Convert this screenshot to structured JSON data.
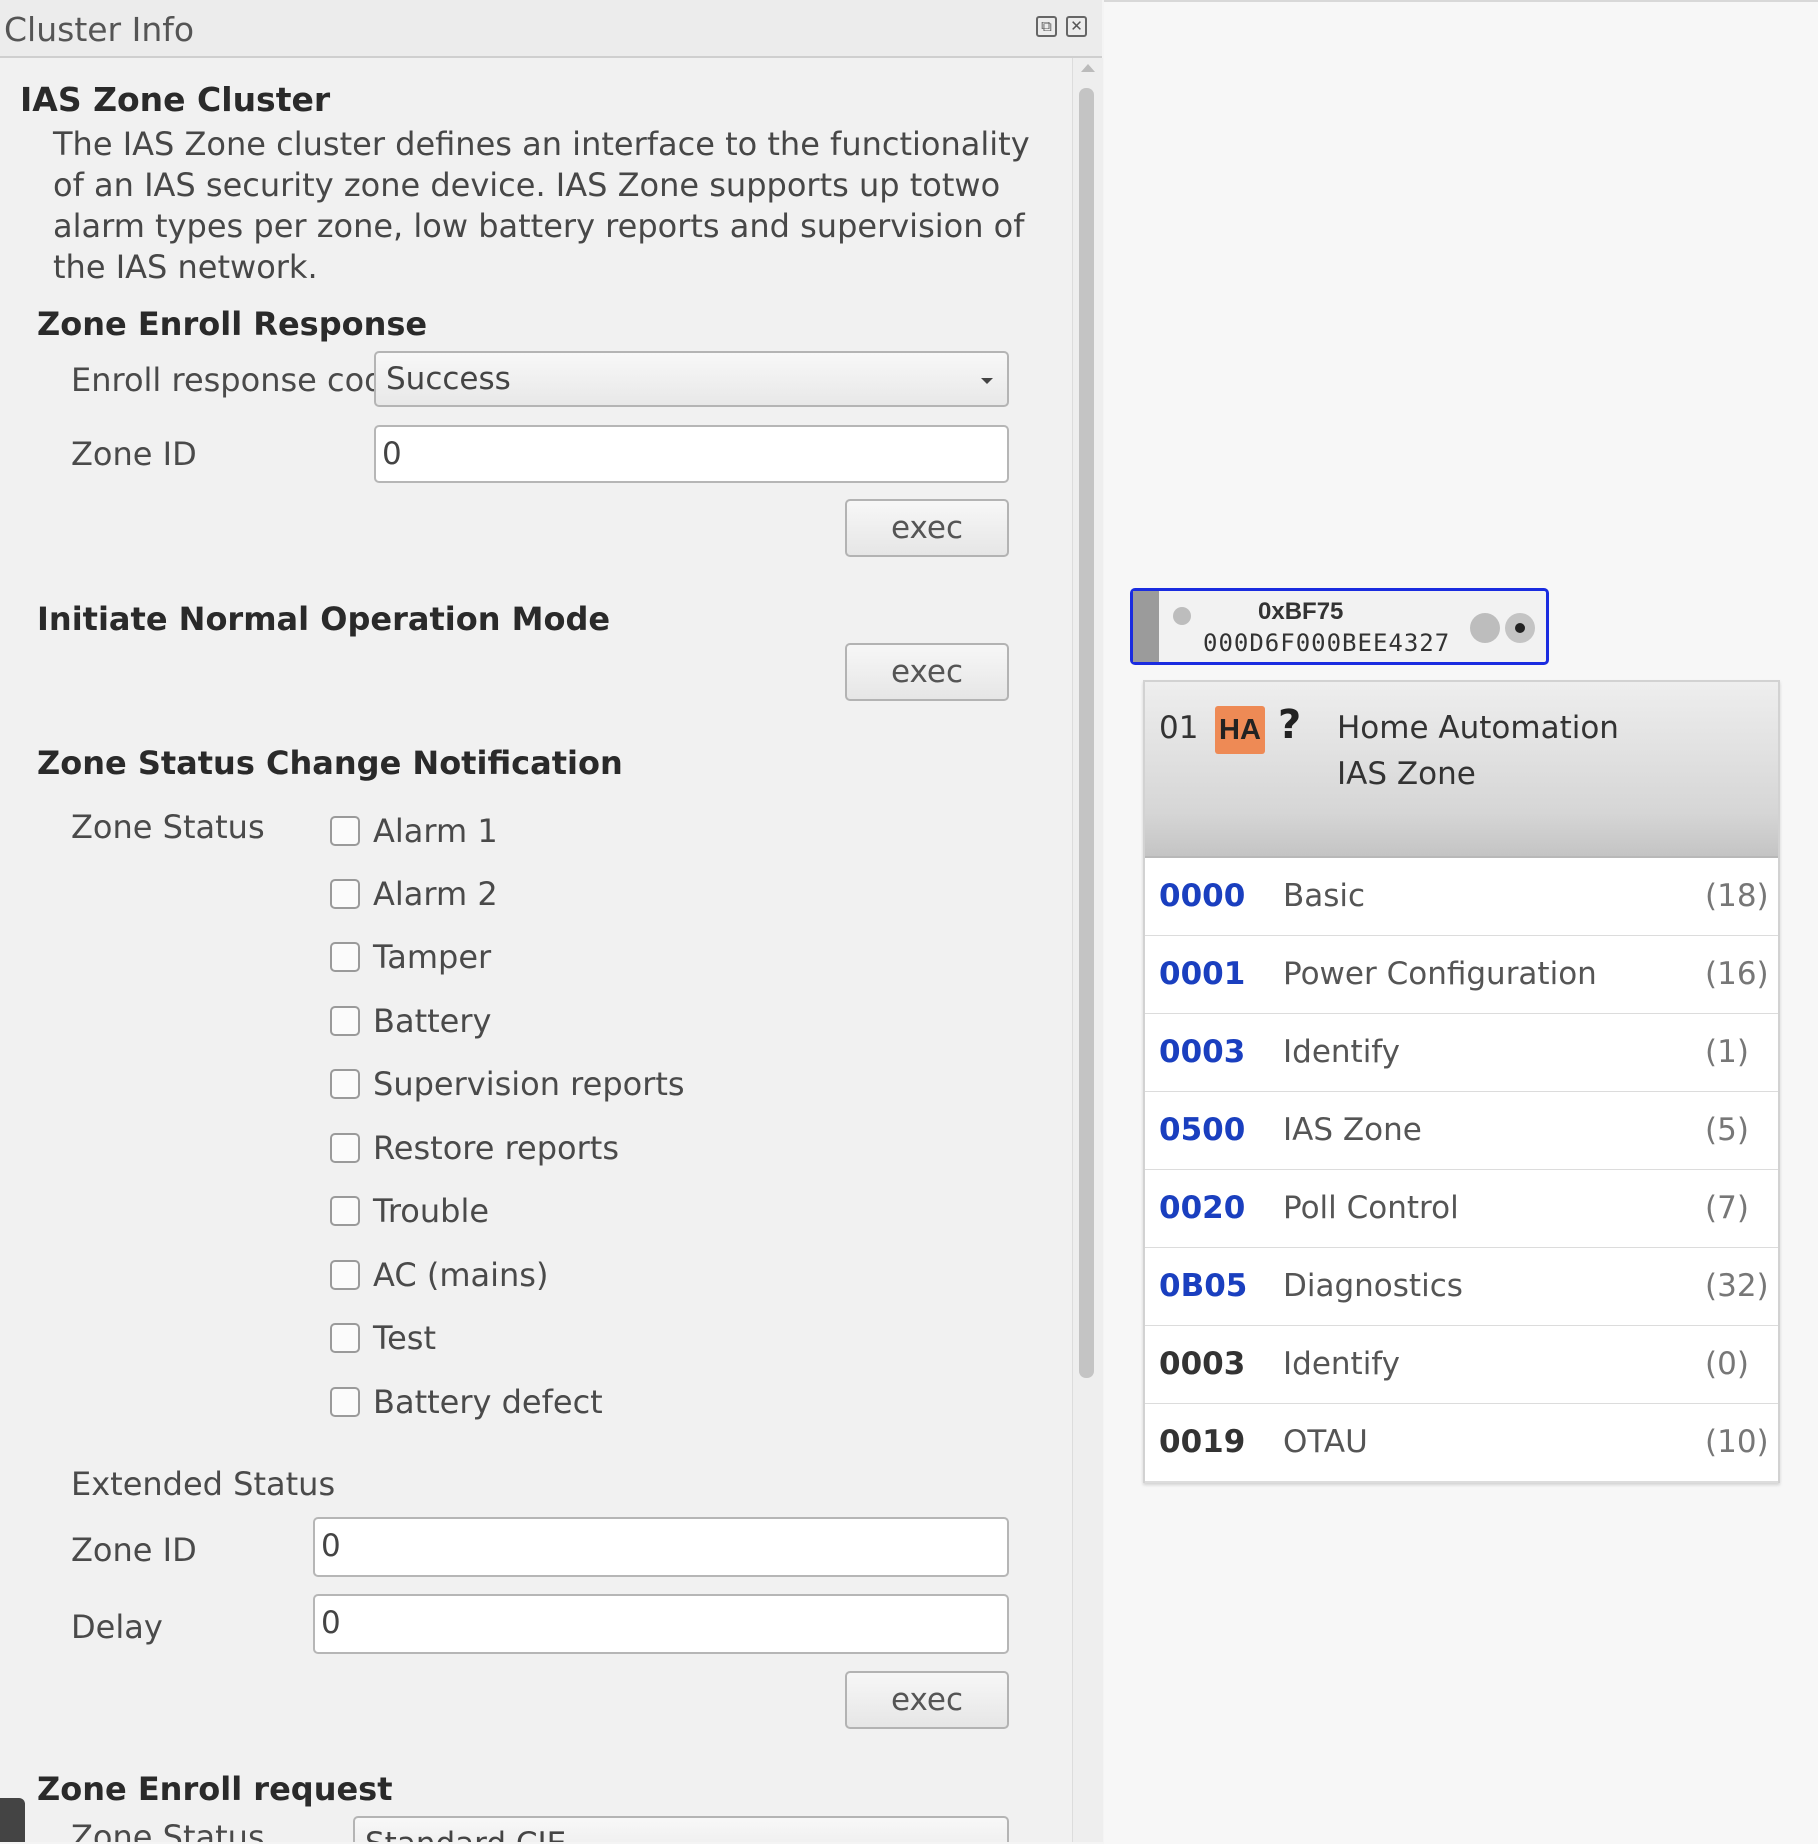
{
  "panel": {
    "title": "Cluster Info",
    "float_icon": "⧉",
    "close_icon": "✕"
  },
  "cluster": {
    "name": "IAS Zone Cluster",
    "description": "The IAS Zone cluster defines an interface to the functionality of an IAS security zone device. IAS Zone supports up totwo alarm types per zone, low battery reports and supervision of the IAS network."
  },
  "zone_enroll_response": {
    "heading": "Zone Enroll Response",
    "code_label": "Enroll response code",
    "code_value": "Success",
    "zone_id_label": "Zone ID",
    "zone_id_value": "0",
    "exec_label": "exec"
  },
  "normal_mode": {
    "heading": "Initiate Normal Operation Mode",
    "exec_label": "exec"
  },
  "status_change": {
    "heading": "Zone Status Change Notification",
    "zone_status_label": "Zone Status",
    "checkboxes": [
      "Alarm 1",
      "Alarm 2",
      "Tamper",
      "Battery",
      "Supervision reports",
      "Restore reports",
      "Trouble",
      "AC (mains)",
      "Test",
      "Battery defect"
    ],
    "extended_status_label": "Extended Status",
    "zone_id_label": "Zone ID",
    "zone_id_value": "0",
    "delay_label": "Delay",
    "delay_value": "0",
    "exec_label": "exec"
  },
  "zone_enroll_request": {
    "heading": "Zone Enroll request",
    "zone_status_label": "Zone Status",
    "zone_status_value": "Standard CIE"
  },
  "node": {
    "short_address": "0xBF75",
    "mac_address": "000D6F000BEE4327",
    "border_color": "#1a2ce0"
  },
  "endpoint": {
    "number": "01",
    "profile_badge": "HA",
    "unknown_symbol": "?",
    "profile": "Home Automation",
    "device": "IAS Zone",
    "badge_color": "#ee8a55",
    "clusters": [
      {
        "id": "0000",
        "name": "Basic",
        "count": "(18)",
        "side": "server"
      },
      {
        "id": "0001",
        "name": "Power Configuration",
        "count": "(16)",
        "side": "server"
      },
      {
        "id": "0003",
        "name": "Identify",
        "count": "(1)",
        "side": "server"
      },
      {
        "id": "0500",
        "name": "IAS Zone",
        "count": "(5)",
        "side": "server"
      },
      {
        "id": "0020",
        "name": "Poll Control",
        "count": "(7)",
        "side": "server"
      },
      {
        "id": "0B05",
        "name": "Diagnostics",
        "count": "(32)",
        "side": "server"
      },
      {
        "id": "0003",
        "name": "Identify",
        "count": "(0)",
        "side": "client"
      },
      {
        "id": "0019",
        "name": "OTAU",
        "count": "(10)",
        "side": "client"
      }
    ],
    "server_color": "#1a3fbf",
    "client_color": "#333333"
  }
}
